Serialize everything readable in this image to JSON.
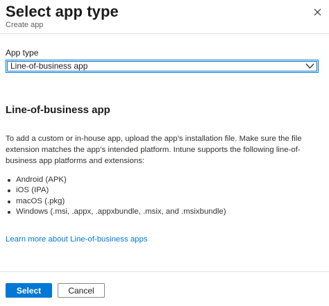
{
  "header": {
    "title": "Select app type",
    "subtitle": "Create app",
    "close_icon": "close-icon"
  },
  "app_type": {
    "label": "App type",
    "selected": "Line-of-business app",
    "chevron_icon": "chevron-down-icon"
  },
  "section": {
    "title": "Line-of-business app",
    "description": "To add a custom or in-house app, upload the app’s installation file. Make sure the file extension matches the app’s intended platform. Intune supports the following line-of-business app platforms and extensions:",
    "platforms": [
      "Android (APK)",
      "iOS (IPA)",
      "macOS (.pkg)",
      "Windows (.msi, .appx, .appxbundle, .msix, and .msixbundle)"
    ],
    "learn_more": "Learn more about Line-of-business apps"
  },
  "footer": {
    "select_label": "Select",
    "cancel_label": "Cancel"
  },
  "colors": {
    "accent": "#0078d4",
    "divider": "#e1dfdd",
    "text": "#1b1b1b",
    "muted": "#605e5c"
  }
}
